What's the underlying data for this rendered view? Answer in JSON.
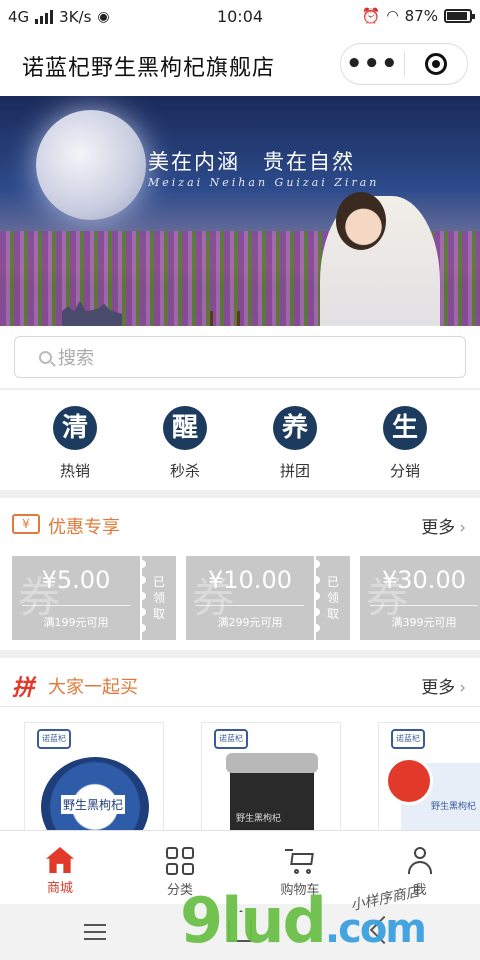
{
  "status_bar": {
    "network": "4G",
    "speed": "3K/s",
    "time": "10:04",
    "battery": "87%"
  },
  "header": {
    "title": "诺蓝杞野生黑枸杞旗舰店",
    "more_icon": "more-dots-icon",
    "close_icon": "target-circle-icon"
  },
  "banner": {
    "slogan": "美在内涵　贵在自然",
    "slogan_en": "Meizai Neihan Guizai Ziran"
  },
  "search": {
    "placeholder": "搜索"
  },
  "quick_nav": [
    {
      "glyph": "清",
      "label": "热销"
    },
    {
      "glyph": "醒",
      "label": "秒杀"
    },
    {
      "glyph": "养",
      "label": "拼团"
    },
    {
      "glyph": "生",
      "label": "分销"
    }
  ],
  "coupons_section": {
    "title": "优惠专享",
    "more": "更多",
    "icon_text": "¥",
    "items": [
      {
        "watermark": "券",
        "amount": "¥5.00",
        "condition": "满199元可用",
        "stub": [
          "已",
          "领",
          "取"
        ]
      },
      {
        "watermark": "券",
        "amount": "¥10.00",
        "condition": "满299元可用",
        "stub": [
          "已",
          "领",
          "取"
        ]
      },
      {
        "watermark": "券",
        "amount": "¥30.00",
        "condition": "满399元可用",
        "stub": [
          "已",
          "领",
          "取"
        ]
      }
    ]
  },
  "group_section": {
    "icon_text": "拼",
    "title": "大家一起买",
    "more": "更多",
    "products": [
      {
        "label": "野生黑枸杞",
        "logo": "诺蓝杞"
      },
      {
        "label": "野生黑枸杞",
        "logo": "诺蓝杞"
      },
      {
        "label": "野生黑枸杞",
        "logo": "诺蓝杞"
      }
    ]
  },
  "tabbar": [
    {
      "label": "商城",
      "icon": "home-icon",
      "active": true
    },
    {
      "label": "分类",
      "icon": "grid-icon",
      "active": false
    },
    {
      "label": "购物车",
      "icon": "cart-icon",
      "active": false
    },
    {
      "label": "我",
      "icon": "user-icon",
      "active": false
    }
  ],
  "watermark": {
    "brand": "9lud",
    "domain": ".com",
    "script": "小样序商店"
  },
  "colors": {
    "accent_red": "#e23a2a",
    "nav_circle": "#1d3b5e",
    "coupon_orange": "#e07a3a",
    "coupon_gray": "#c8c8c8"
  }
}
